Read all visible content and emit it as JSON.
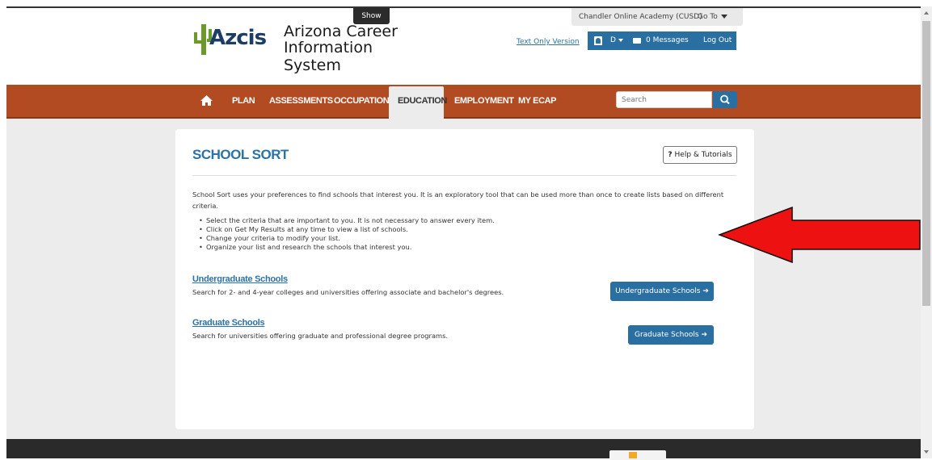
{
  "header": {
    "show_label": "Show",
    "org_name": "Chandler Online Academy (CUSD)",
    "goto_label": "Go To",
    "logo_text": "Azcis",
    "title_line1": "Arizona Career",
    "title_line2": "Information System",
    "text_only_link": "Text Only Version",
    "user_initial": "D",
    "messages_label": "0 Messages",
    "logout_label": "Log Out"
  },
  "nav": {
    "items": [
      "PLAN",
      "ASSESSMENTS",
      "OCCUPATIONS",
      "EDUCATION",
      "EMPLOYMENT",
      "MY ECAP"
    ],
    "active": "EDUCATION",
    "search_placeholder": "Search"
  },
  "main": {
    "title": "SCHOOL SORT",
    "help_label": "Help & Tutorials",
    "intro": "School Sort uses your preferences to find schools that interest you. It is an exploratory tool that can be used more than once to create lists based on different criteria.",
    "bullets": [
      "Select the criteria that are important to you. It is not necessary to answer every item.",
      "Click on Get My Results at any time to view a list of schools.",
      "Change your criteria to modify your list.",
      "Organize your list and research the schools that interest you."
    ],
    "undergrad": {
      "title": "Undergraduate Schools",
      "description": "Search for 2- and 4-year colleges and universities offering associate and bachelor's degrees.",
      "button": "Undergraduate Schools"
    },
    "graduate": {
      "title": "Graduate Schools",
      "description": "Search for universities offering graduate and professional degree programs.",
      "button": "Graduate Schools"
    }
  },
  "colors": {
    "nav_bg": "#b24a22",
    "accent_blue": "#2a6fa2",
    "arrow_red": "#ee1111"
  },
  "icons": [
    "home-icon",
    "search-icon",
    "user-icon",
    "envelope-icon",
    "question-icon",
    "arrow-right-icon",
    "red-arrow-annotation"
  ]
}
